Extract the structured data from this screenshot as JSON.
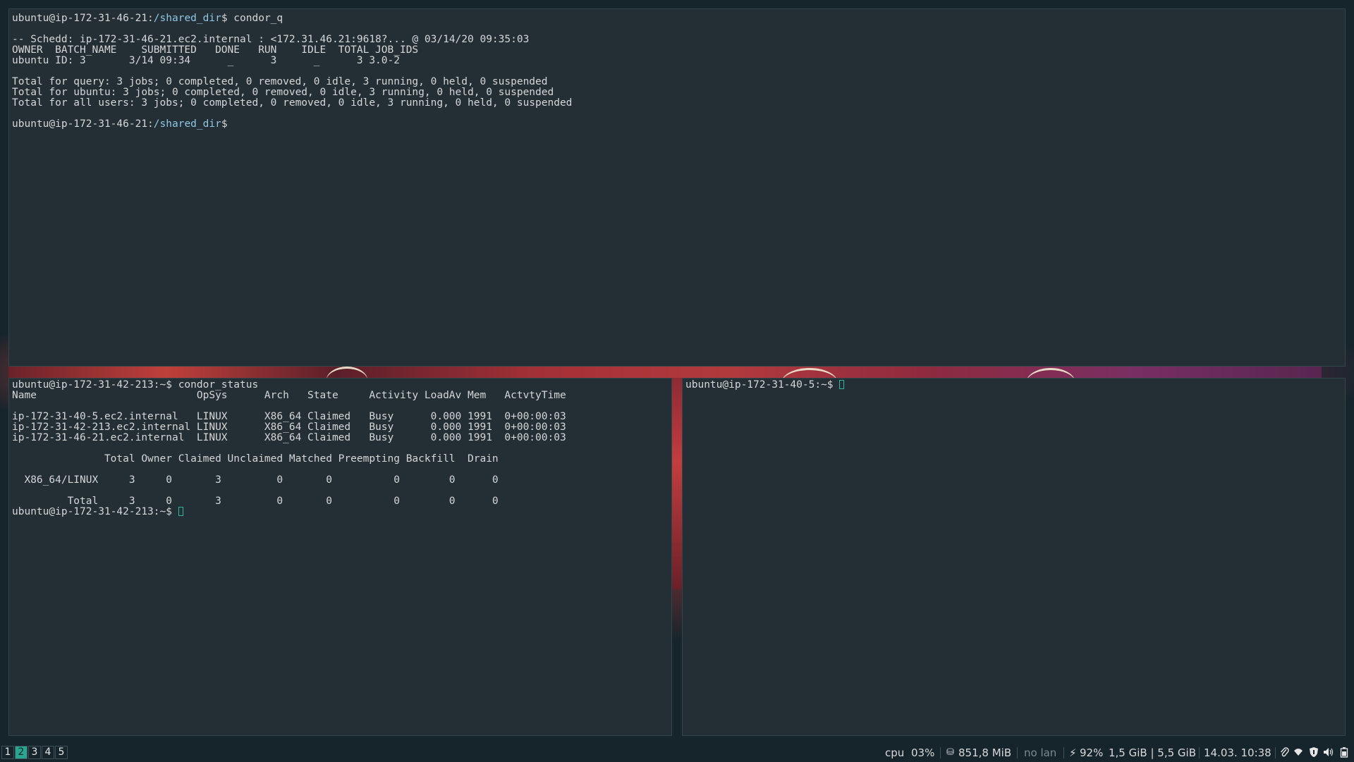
{
  "top_terminal": {
    "prompt_user": "ubuntu@ip-172-31-46-21:",
    "prompt_path": "/shared_dir",
    "prompt_end": "$ ",
    "command": "condor_q",
    "blank1": "",
    "schedd_line": "-- Schedd: ip-172-31-46-21.ec2.internal : <172.31.46.21:9618?... @ 03/14/20 09:35:03",
    "header_line": "OWNER  BATCH_NAME    SUBMITTED   DONE   RUN    IDLE  TOTAL JOB_IDS",
    "job_line": "ubuntu ID: 3       3/14 09:34      _      3      _      3 3.0-2",
    "blank2": "",
    "total_query": "Total for query: 3 jobs; 0 completed, 0 removed, 0 idle, 3 running, 0 held, 0 suspended",
    "total_ubuntu": "Total for ubuntu: 3 jobs; 0 completed, 0 removed, 0 idle, 3 running, 0 held, 0 suspended",
    "total_all": "Total for all users: 3 jobs; 0 completed, 0 removed, 0 idle, 3 running, 0 held, 0 suspended",
    "blank3": "",
    "prompt2_user": "ubuntu@ip-172-31-46-21:",
    "prompt2_path": "/shared_dir",
    "prompt2_end": "$"
  },
  "bottom_left_terminal": {
    "prompt": "ubuntu@ip-172-31-42-213:~$ ",
    "command": "condor_status",
    "header_line": "Name                          OpSys      Arch   State     Activity LoadAv Mem   ActvtyTime",
    "blank1": "",
    "rows": [
      "ip-172-31-40-5.ec2.internal   LINUX      X86_64 Claimed   Busy      0.000 1991  0+00:00:03",
      "ip-172-31-42-213.ec2.internal LINUX      X86_64 Claimed   Busy      0.000 1991  0+00:00:03",
      "ip-172-31-46-21.ec2.internal  LINUX      X86_64 Claimed   Busy      0.000 1991  0+00:00:03"
    ],
    "blank2": "",
    "summary_header": "               Total Owner Claimed Unclaimed Matched Preempting Backfill  Drain",
    "blank3": "",
    "summary_arch": "  X86_64/LINUX     3     0       3         0       0          0        0      0",
    "blank4": "",
    "summary_total": "         Total     3     0       3         0       0          0        0      0",
    "prompt2": "ubuntu@ip-172-31-42-213:~$ "
  },
  "bottom_right_terminal": {
    "prompt": "ubuntu@ip-172-31-40-5:~$ "
  },
  "taskbar": {
    "workspaces": [
      "1",
      "2",
      "3",
      "4",
      "5"
    ],
    "active_workspace": "2",
    "cpu_label": "cpu",
    "cpu_value": "03%",
    "mem_icon": "⛁",
    "mem_value": "851,8 MiB",
    "lan_status": "no lan",
    "battery_icon": "⚡",
    "battery_value": "92%",
    "disk_value": "1,5 GiB | 5,5 GiB",
    "datetime": "14.03. 10:38",
    "tray_icons": [
      "paperclip-icon",
      "wifi-icon",
      "shield-icon",
      "volume-icon",
      "battery-tray-icon"
    ]
  },
  "colors": {
    "terminal_bg": "#232f35",
    "desktop_bg": "#16252b",
    "path_color": "#8ec7e6",
    "accent": "#2aa590"
  }
}
